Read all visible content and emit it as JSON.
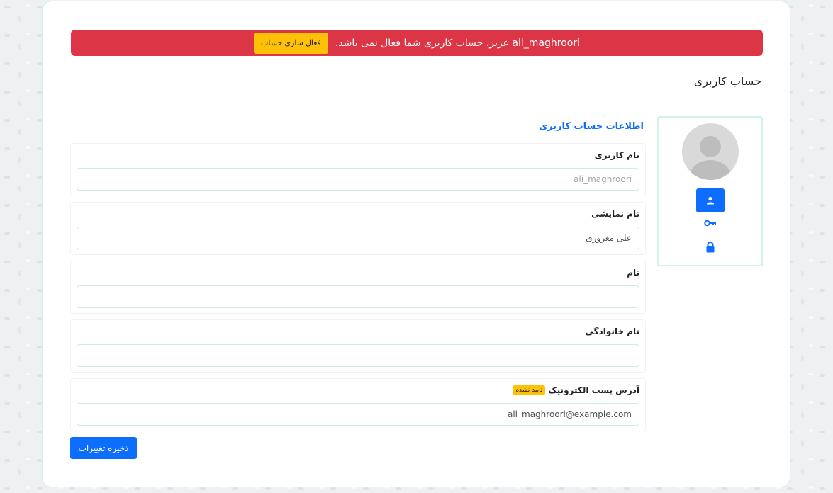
{
  "alert": {
    "message": "ali_maghroori عزیز، حساب کاربری شما فعال نمی باشد.",
    "activate_label": "فعال سازی حساب"
  },
  "page": {
    "title": "حساب کاربری"
  },
  "sidebar": {
    "avatar_icon": "user-avatar-placeholder",
    "items": [
      {
        "icon": "user-icon",
        "active": true
      },
      {
        "icon": "key-icon",
        "active": false
      },
      {
        "icon": "lock-icon",
        "active": false
      }
    ]
  },
  "form": {
    "section_title": "اطلاعات حساب کاربری",
    "username": {
      "label": "نام کاربری",
      "value": "ali_maghroori"
    },
    "display_name": {
      "label": "نام نمایشی",
      "value": "علی مغروری"
    },
    "first_name": {
      "label": "نام",
      "value": ""
    },
    "last_name": {
      "label": "نام خانوادگی",
      "value": ""
    },
    "email": {
      "label": "آدرس پست الکترونیک",
      "badge": "تایید نشده",
      "value": "ali_maghroori@example.com"
    },
    "save_label": "ذخیره تغییرات"
  },
  "colors": {
    "alert": "#dc3545",
    "primary": "#0d6efd",
    "warning": "#ffc107"
  }
}
